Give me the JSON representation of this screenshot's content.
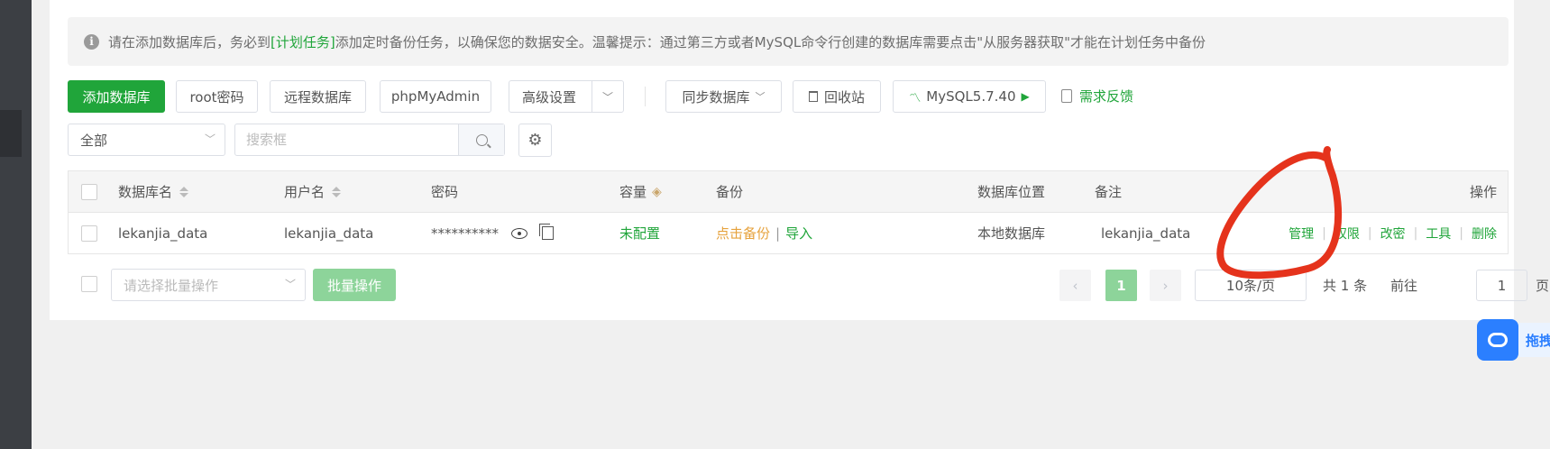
{
  "notice": {
    "text_before": "请在添加数据库后，务必到",
    "link": "[计划任务]",
    "text_after": "添加定时备份任务，以确保您的数据安全。温馨提示：通过第三方或者MySQL命令行创建的数据库需要点击\"从服务器获取\"才能在计划任务中备份",
    "icon": "info-icon"
  },
  "toolbar": {
    "add_db": "添加数据库",
    "root_password": "root密码",
    "remote_db": "远程数据库",
    "phpmyadmin": "phpMyAdmin",
    "advanced": "高级设置",
    "sync_db": "同步数据库",
    "recycle": "回收站",
    "mysql_version": "MySQL5.7.40",
    "feedback": "需求反馈"
  },
  "filter": {
    "category_selected": "全部",
    "search_placeholder": "搜索框"
  },
  "table": {
    "headers": {
      "db_name": "数据库名",
      "username": "用户名",
      "password": "密码",
      "capacity": "容量",
      "backup": "备份",
      "location": "数据库位置",
      "remark": "备注",
      "actions": "操作"
    },
    "rows": [
      {
        "db_name": "lekanjia_data",
        "username": "lekanjia_data",
        "password": "**********",
        "capacity": "未配置",
        "backup_click": "点击备份",
        "backup_sep": "|",
        "import": "导入",
        "location": "本地数据库",
        "remark": "lekanjia_data",
        "actions": [
          "管理",
          "权限",
          "改密",
          "工具",
          "删除"
        ]
      }
    ]
  },
  "footer": {
    "bulk_placeholder": "请选择批量操作",
    "bulk_button": "批量操作",
    "prev": "‹",
    "next": "›",
    "current_page": "1",
    "page_size": "10条/页",
    "total": "共 1 条",
    "goto_label": "前往",
    "goto_value": "1",
    "page_unit": "页"
  },
  "cloud_widget": {
    "label": "拖拽"
  },
  "colors": {
    "accent": "#20a53a",
    "warning": "#e6a23c",
    "annotation": "#e5331c",
    "cloud": "#2b7fff"
  }
}
